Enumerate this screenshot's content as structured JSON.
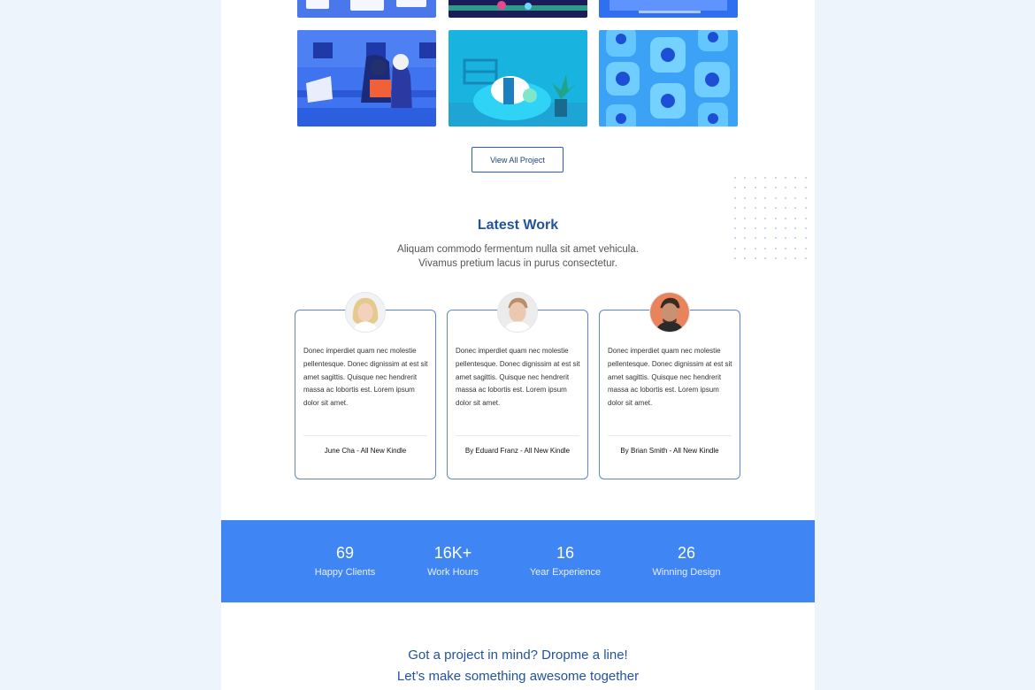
{
  "portfolio": {
    "view_all_label": "View All Project"
  },
  "latest_work": {
    "title": "Latest Work",
    "subtitle_line1": "Aliquam commodo fermentum nulla sit amet vehicula.",
    "subtitle_line2": "Vivamus pretium lacus in purus consectetur."
  },
  "testimonials": [
    {
      "text": "Donec imperdiet quam nec molestie pellentesque. Donec dignissim at est sit amet sagittis. Quisque nec hendrerit massa ac lobortis est. Lorem ipsum dolor sit amet.",
      "author": "June Cha - All New Kindle"
    },
    {
      "text": "Donec imperdiet quam nec molestie pellentesque. Donec dignissim at est sit amet sagittis. Quisque nec hendrerit massa ac lobortis est. Lorem ipsum dolor sit amet.",
      "author": "By Eduard Franz - All New Kindle"
    },
    {
      "text": "Donec imperdiet quam nec molestie pellentesque. Donec dignissim at est sit amet sagittis. Quisque nec hendrerit massa ac lobortis est. Lorem ipsum dolor sit amet.",
      "author": "By Brian Smith - All New Kindle"
    }
  ],
  "stats": [
    {
      "value": "69",
      "label": "Happy Clients"
    },
    {
      "value": "16K+",
      "label": "Work Hours"
    },
    {
      "value": "16",
      "label": "Year Experience"
    },
    {
      "value": "26",
      "label": "Winning Design"
    }
  ],
  "cta": {
    "line1": "Got a project in mind? Dropme a line!",
    "line2": "Let’s make something awesome together"
  },
  "colors": {
    "page_bg": "#eef4fc",
    "accent_blue": "#3f86f4",
    "heading_blue": "#22539e",
    "card_border": "#5d86cf"
  }
}
